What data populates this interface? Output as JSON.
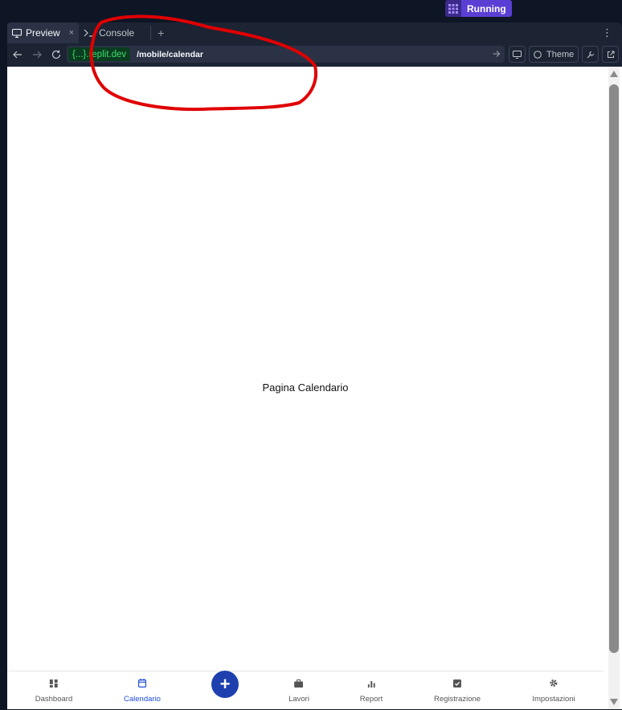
{
  "topbar": {
    "run_label": "Running"
  },
  "tabs": [
    {
      "label": "Preview",
      "close": "×"
    },
    {
      "label": "Console"
    }
  ],
  "tab_add": "+",
  "menu_icon": "⋮",
  "urlbar": {
    "host": "{...}.replit.dev",
    "path": "/mobile/calendar",
    "theme_label": "Theme"
  },
  "page": {
    "center_text": "Pagina Calendario"
  },
  "bottom_nav": {
    "items": [
      {
        "label": "Dashboard",
        "icon": "grid-icon"
      },
      {
        "label": "Calendario",
        "icon": "calendar-icon"
      },
      {
        "label": "Lavori",
        "icon": "briefcase-icon"
      },
      {
        "label": "Report",
        "icon": "bar-chart-icon"
      },
      {
        "label": "Registrazione",
        "icon": "check-box-icon"
      },
      {
        "label": "Impostazioni",
        "icon": "gear-icon"
      }
    ],
    "fab_label": "+"
  },
  "colors": {
    "accent": "#1e40af",
    "active_nav": "#1e4ed8",
    "run_button": "#5b3fd4",
    "annotation": "#e00000"
  }
}
